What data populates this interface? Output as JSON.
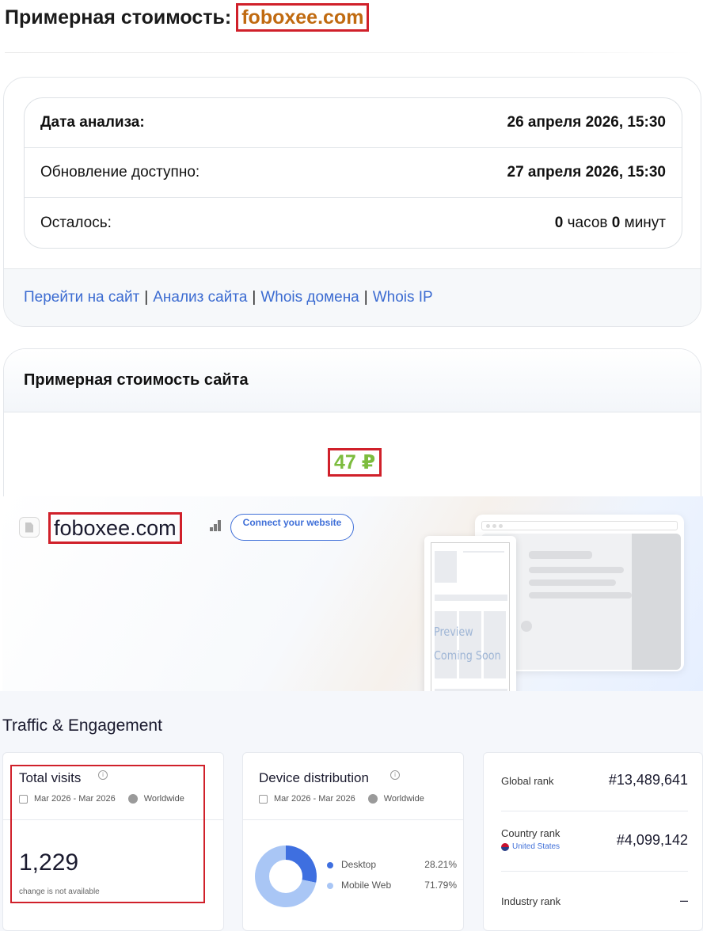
{
  "header": {
    "title": "Примерная стоимость:",
    "domain": "foboxee.com"
  },
  "info": {
    "rows": [
      {
        "label": "Дата анализа:",
        "value": "26 апреля 2026, 15:30"
      },
      {
        "label": "Обновление доступно:",
        "value": "27 апреля 2026, 15:30"
      },
      {
        "label": "Осталось:",
        "hours": "0",
        "hours_unit": "часов",
        "minutes": "0",
        "minutes_unit": "минут"
      }
    ],
    "links": [
      "Перейти на сайт",
      "Анализ сайта",
      "Whois домена",
      "Whois IP"
    ],
    "separator": "|"
  },
  "price": {
    "heading": "Примерная стоимость сайта",
    "value": "47 ₽"
  },
  "similarweb": {
    "site": "foboxee.com",
    "connect_label": "Connect your website",
    "preview_line1": "Preview",
    "preview_line2": "Coming Soon",
    "section_title": "Traffic & Engagement",
    "visits": {
      "title": "Total visits",
      "period": "Mar 2026 - Mar 2026",
      "region": "Worldwide",
      "value": "1,229",
      "note": "change is not available"
    },
    "device": {
      "title": "Device distribution",
      "period": "Mar 2026 - Mar 2026",
      "region": "Worldwide",
      "items": [
        {
          "label": "Desktop",
          "percent": "28.21%",
          "share": 28.21,
          "color": "#3e6fe0"
        },
        {
          "label": "Mobile Web",
          "percent": "71.79%",
          "share": 71.79,
          "color": "#a9c6f5"
        }
      ]
    },
    "ranks": {
      "global_label": "Global rank",
      "global_value": "#13,489,641",
      "country_label": "Country rank",
      "country_name": "United States",
      "country_value": "#4,099,142",
      "industry_label": "Industry rank",
      "industry_value": "–"
    }
  }
}
